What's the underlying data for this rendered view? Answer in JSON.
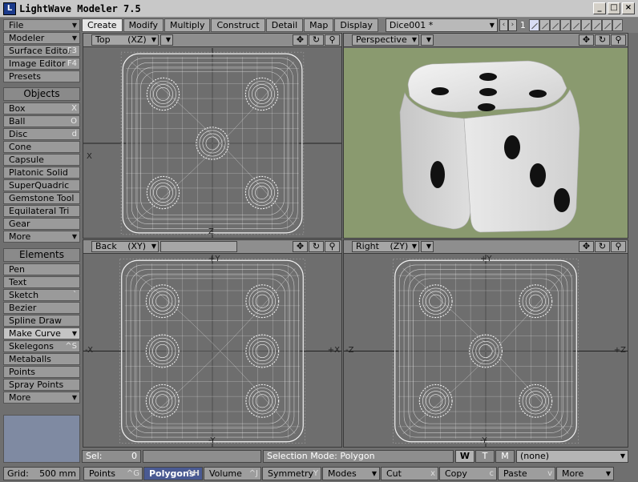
{
  "window": {
    "title": "LightWave Modeler 7.5",
    "icon": "lightwave-icon",
    "controls": {
      "min": "_",
      "max": "□",
      "close": "×"
    }
  },
  "tabs": [
    "Create",
    "Modify",
    "Multiply",
    "Construct",
    "Detail",
    "Map",
    "Display"
  ],
  "active_tab": "Create",
  "object_name": "Dice001 *",
  "layer_number": "1",
  "sidebar": {
    "file": "File",
    "modeler": "Modeler",
    "surface_editor": "Surface Editor",
    "surface_editor_key": "F3",
    "image_editor": "Image Editor",
    "image_editor_key": "F4",
    "presets": "Presets",
    "objects_header": "Objects",
    "objects": [
      {
        "label": "Box",
        "key": "X"
      },
      {
        "label": "Ball",
        "key": "O"
      },
      {
        "label": "Disc",
        "key": "d"
      },
      {
        "label": "Cone",
        "key": ""
      },
      {
        "label": "Capsule",
        "key": ""
      },
      {
        "label": "Platonic Solid",
        "key": ""
      },
      {
        "label": "SuperQuadric",
        "key": ""
      },
      {
        "label": "Gemstone Tool",
        "key": ""
      },
      {
        "label": "Equilateral Tri",
        "key": ""
      },
      {
        "label": "Gear",
        "key": ""
      },
      {
        "label": "More",
        "key": ""
      }
    ],
    "elements_header": "Elements",
    "elements": [
      {
        "label": "Pen",
        "key": ""
      },
      {
        "label": "Text",
        "key": ""
      },
      {
        "label": "Sketch",
        "key": "`"
      },
      {
        "label": "Bezier",
        "key": ""
      },
      {
        "label": "Spline Draw",
        "key": ""
      },
      {
        "label": "Make Curve",
        "key": ""
      },
      {
        "label": "Skelegons",
        "key": "^S"
      },
      {
        "label": "Metaballs",
        "key": ""
      },
      {
        "label": "Points",
        "key": ""
      },
      {
        "label": "Spray Points",
        "key": ""
      },
      {
        "label": "More",
        "key": ""
      }
    ]
  },
  "viewports": {
    "top": {
      "view": "Top",
      "axes": "(XZ)",
      "left_label": "X",
      "bottom_label": "Z"
    },
    "perspective": {
      "view": "Perspective"
    },
    "back": {
      "view": "Back",
      "axes": "(XY)",
      "top_label": "+Y",
      "left_label": "-X",
      "right_label": "+X",
      "bottom_label": "-Y"
    },
    "right": {
      "view": "Right",
      "axes": "(ZY)",
      "top_label": "+Y",
      "left_label": "-Z",
      "right_label": "+Z",
      "bottom_label": "-Y"
    },
    "tool_glyphs": {
      "move": "✥",
      "rotate": "↻",
      "zoom": "⚲"
    }
  },
  "status": {
    "sel_label": "Sel:",
    "sel_value": "0",
    "selection_mode_label": "Selection Mode:",
    "selection_mode": "Polygon",
    "w": "W",
    "t": "T",
    "m": "M",
    "surface": "(none)"
  },
  "bottom": {
    "grid_label": "Grid:",
    "grid_value": "500 mm",
    "points": "Points",
    "points_key": "^G",
    "polygons": "Polygons",
    "polygons_key": "^H",
    "volume": "Volume",
    "volume_key": "^J",
    "symmetry": "Symmetry",
    "symmetry_key": "Y",
    "modes": "Modes",
    "cut": "Cut",
    "cut_key": "x",
    "copy": "Copy",
    "copy_key": "c",
    "paste": "Paste",
    "paste_key": "v",
    "more": "More"
  },
  "colors": {
    "perspective_bg": "#8a9a6f",
    "die_face": "#e2e2e2",
    "pip": "#111111",
    "wire": "#f2f2f2",
    "selection_blue": "#4a5a92"
  }
}
